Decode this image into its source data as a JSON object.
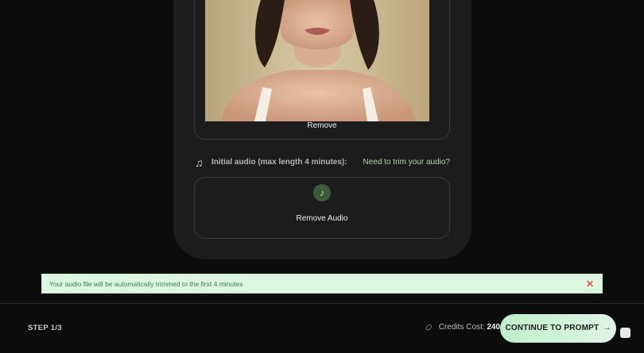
{
  "image_upload": {
    "remove_label": "Remove"
  },
  "audio": {
    "label": "Initial audio (max length 4 minutes):",
    "trim_link": "Need to trim your audio?",
    "remove_label": "Remove Audio",
    "icon": "music-note-icon"
  },
  "notice": {
    "text": "Your audio file will be automatically trimmed to the first 4 minutes",
    "close_icon": "close-icon"
  },
  "footer": {
    "step": "STEP 1/3",
    "credits_label": "Credits Cost:",
    "credits_value": "240",
    "continue_label": "CONTINUE TO PROMPT",
    "chat_icon": "chat-icon"
  },
  "colors": {
    "accent_green": "#bff0c9",
    "notice_bg": "#dcf6df",
    "close_red": "#d9534f"
  }
}
